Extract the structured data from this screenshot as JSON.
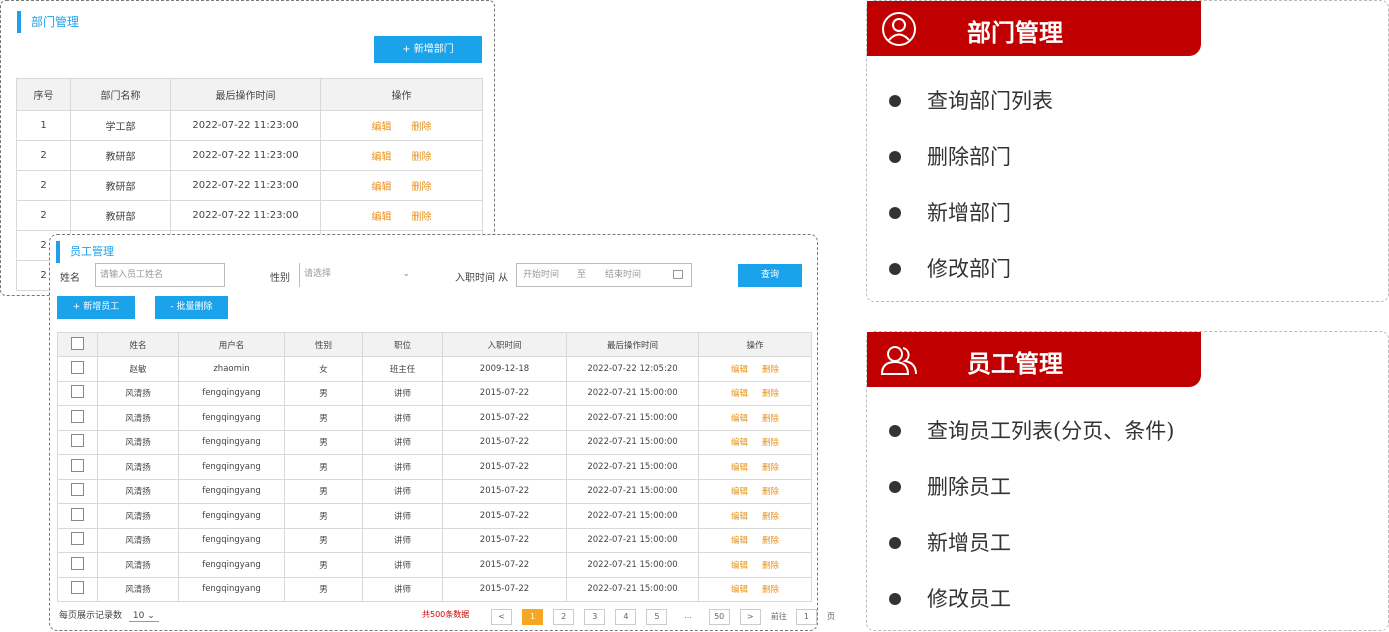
{
  "dept_panel": {
    "title": "部门管理",
    "add_button": "+ 新增部门",
    "columns": [
      "序号",
      "部门名称",
      "最后操作时间",
      "操作"
    ],
    "rows": [
      {
        "no": "1",
        "name": "学工部",
        "time": "2022-07-22 11:23:00"
      },
      {
        "no": "2",
        "name": "教研部",
        "time": "2022-07-22 11:23:00"
      },
      {
        "no": "2",
        "name": "教研部",
        "time": "2022-07-22 11:23:00"
      },
      {
        "no": "2",
        "name": "教研部",
        "time": "2022-07-22 11:23:00"
      },
      {
        "no": "2",
        "name": "",
        "time": ""
      },
      {
        "no": "2",
        "name": "",
        "time": ""
      }
    ],
    "edit_label": "编辑",
    "delete_label": "删除"
  },
  "emp_panel": {
    "title": "员工管理",
    "filter": {
      "name_label": "姓名",
      "name_placeholder": "请输入员工姓名",
      "gender_label": "性别",
      "gender_placeholder": "请选择",
      "date_label": "入职时间 从",
      "date_start": "开始时间",
      "date_sep": "至",
      "date_end": "结束时间",
      "query_button": "查询"
    },
    "add_button": "+ 新增员工",
    "batch_delete_button": "- 批量删除",
    "columns": [
      "姓名",
      "用户名",
      "性别",
      "职位",
      "入职时间",
      "最后操作时间",
      "操作"
    ],
    "rows": [
      {
        "name": "赵敏",
        "username": "zhaomin",
        "gender": "女",
        "job": "班主任",
        "entry": "2009-12-18",
        "updated": "2022-07-22 12:05:20"
      },
      {
        "name": "风清扬",
        "username": "fengqingyang",
        "gender": "男",
        "job": "讲师",
        "entry": "2015-07-22",
        "updated": "2022-07-21 15:00:00"
      },
      {
        "name": "风清扬",
        "username": "fengqingyang",
        "gender": "男",
        "job": "讲师",
        "entry": "2015-07-22",
        "updated": "2022-07-21 15:00:00"
      },
      {
        "name": "风清扬",
        "username": "fengqingyang",
        "gender": "男",
        "job": "讲师",
        "entry": "2015-07-22",
        "updated": "2022-07-21 15:00:00"
      },
      {
        "name": "风清扬",
        "username": "fengqingyang",
        "gender": "男",
        "job": "讲师",
        "entry": "2015-07-22",
        "updated": "2022-07-21 15:00:00"
      },
      {
        "name": "风清扬",
        "username": "fengqingyang",
        "gender": "男",
        "job": "讲师",
        "entry": "2015-07-22",
        "updated": "2022-07-21 15:00:00"
      },
      {
        "name": "风清扬",
        "username": "fengqingyang",
        "gender": "男",
        "job": "讲师",
        "entry": "2015-07-22",
        "updated": "2022-07-21 15:00:00"
      },
      {
        "name": "风清扬",
        "username": "fengqingyang",
        "gender": "男",
        "job": "讲师",
        "entry": "2015-07-22",
        "updated": "2022-07-21 15:00:00"
      },
      {
        "name": "风清扬",
        "username": "fengqingyang",
        "gender": "男",
        "job": "讲师",
        "entry": "2015-07-22",
        "updated": "2022-07-21 15:00:00"
      },
      {
        "name": "风清扬",
        "username": "fengqingyang",
        "gender": "男",
        "job": "讲师",
        "entry": "2015-07-22",
        "updated": "2022-07-21 15:00:00"
      }
    ],
    "edit_label": "编辑",
    "delete_label": "删除",
    "pagination": {
      "page_size_label": "每页展示记录数",
      "page_size": "10",
      "total_text": "共500条数据",
      "prev": "<",
      "pages": [
        "1",
        "2",
        "3",
        "4",
        "5",
        "50"
      ],
      "ellipsis": "...",
      "next": ">",
      "goto_prefix": "前往",
      "goto_value": "1",
      "goto_suffix": "页"
    }
  },
  "cards": [
    {
      "title": "部门管理",
      "icon": "user-icon",
      "items": [
        "查询部门列表",
        "删除部门",
        "新增部门",
        "修改部门"
      ]
    },
    {
      "title": "员工管理",
      "icon": "users-icon",
      "items": [
        "查询员工列表(分页、条件)",
        "删除员工",
        "新增员工",
        "修改员工"
      ]
    }
  ],
  "colors": {
    "accent_blue": "#1aa3ea",
    "action_orange": "#e6921e",
    "card_red": "#c00000"
  }
}
